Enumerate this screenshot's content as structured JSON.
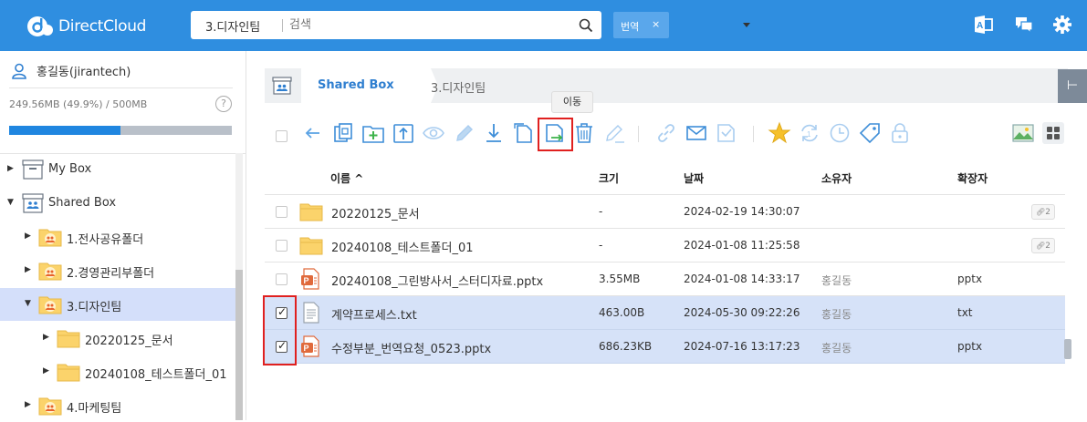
{
  "app": {
    "brand": "DirectCloud"
  },
  "search": {
    "folder": "3.디자인팀",
    "placeholder": "검색"
  },
  "chip": {
    "label": "번역",
    "close": "×"
  },
  "user": {
    "name": "홍길동(jirantech)",
    "quota_text": "249.56MB (49.9%) / 500MB",
    "quota_percent": 49.9,
    "help": "?"
  },
  "tree": [
    {
      "label": "My Box",
      "level": 0,
      "icon": "box-icon",
      "expanded": false,
      "selected": false
    },
    {
      "label": "Shared Box",
      "level": 0,
      "icon": "shared-box-icon",
      "expanded": true,
      "selected": false
    },
    {
      "label": "1.전사공유폴더",
      "level": 1,
      "icon": "shared-folder-icon",
      "expanded": false,
      "selected": false
    },
    {
      "label": "2.경영관리부폴더",
      "level": 1,
      "icon": "shared-folder-icon",
      "expanded": false,
      "selected": false
    },
    {
      "label": "3.디자인팀",
      "level": 1,
      "icon": "shared-folder-icon",
      "expanded": true,
      "selected": true
    },
    {
      "label": "20220125_문서",
      "level": 2,
      "icon": "folder-icon",
      "expanded": false,
      "selected": false
    },
    {
      "label": "20240108_테스트폴더_01",
      "level": 2,
      "icon": "folder-icon",
      "expanded": false,
      "selected": false
    },
    {
      "label": "4.마케팅팀",
      "level": 1,
      "icon": "shared-folder-icon",
      "expanded": false,
      "selected": false
    }
  ],
  "breadcrumb": {
    "root": "Shared Box",
    "current": "3.디자인팀"
  },
  "tooltip": "이동",
  "table": {
    "headers": {
      "name": "이름",
      "sort": "^",
      "size": "크기",
      "date": "날짜",
      "owner": "소유자",
      "ext": "확장자"
    },
    "rows": [
      {
        "type": "folder",
        "name": "20220125_문서",
        "size": "-",
        "date": "2024-02-19 14:30:07",
        "owner": "",
        "ext": "",
        "share": "2",
        "checked": false
      },
      {
        "type": "folder",
        "name": "20240108_테스트폴더_01",
        "size": "-",
        "date": "2024-01-08 11:25:58",
        "owner": "",
        "ext": "",
        "share": "2",
        "checked": false
      },
      {
        "type": "pptx",
        "name": "20240108_그린방사서_스터디자료.pptx",
        "size": "3.55MB",
        "date": "2024-01-08 14:33:17",
        "owner": "홍길동",
        "ext": "pptx",
        "share": "",
        "checked": false
      },
      {
        "type": "txt",
        "name": "계약프로세스.txt",
        "size": "463.00B",
        "date": "2024-05-30 09:22:26",
        "owner": "홍길동",
        "ext": "txt",
        "share": "",
        "checked": true
      },
      {
        "type": "pptx",
        "name": "수정부분_번역요청_0523.pptx",
        "size": "686.23KB",
        "date": "2024-07-16 13:17:23",
        "owner": "홍길동",
        "ext": "pptx",
        "share": "",
        "checked": true
      }
    ]
  },
  "colors": {
    "topbar": "#2f8ee0",
    "accent": "#1f86e0",
    "selected_row": "#d6e2f8",
    "highlight_box": "#e0201f"
  }
}
